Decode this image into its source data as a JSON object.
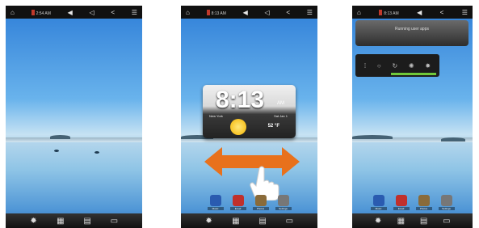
{
  "screens": [
    {
      "status": {
        "time": "2:54 AM"
      }
    },
    {
      "status": {
        "time": "8:13 AM"
      },
      "clock_widget": {
        "time": "8:13",
        "ampm": "AM",
        "date": "Sat Jan 1",
        "city": "New York",
        "condition": "Partly Cloudy",
        "temperature": "52 °F"
      },
      "apps": [
        "Music",
        "Email",
        "Photos",
        "Settings"
      ]
    },
    {
      "status": {
        "time": "8:13 AM"
      },
      "notification": "Running user apps",
      "apps": [
        "Music",
        "Email",
        "Photos",
        "Settings"
      ]
    }
  ],
  "colors": {
    "arrow": "#e8711c",
    "status_bar": "#111111",
    "accent": "#6fc83a"
  }
}
